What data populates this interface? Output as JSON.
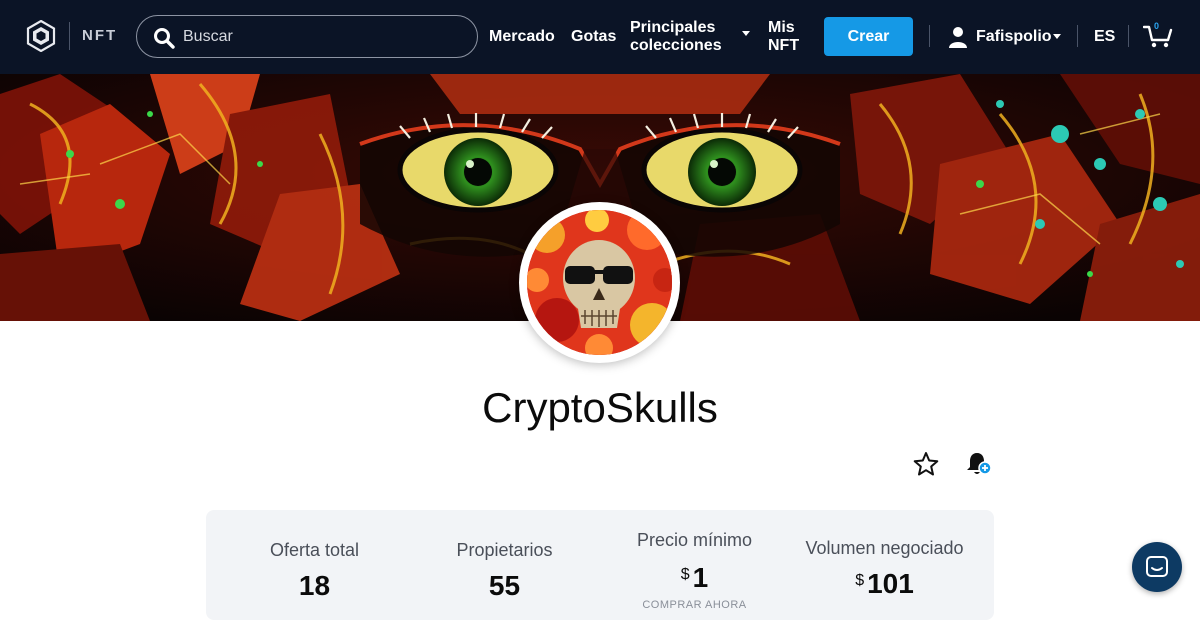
{
  "header": {
    "brand_label": "NFT",
    "search_placeholder": "Buscar",
    "nav": {
      "mercado": "Mercado",
      "gotas": "Gotas",
      "principales_line1": "Principales",
      "principales_line2": "colecciones",
      "mis_line1": "Mis",
      "mis_line2": "NFT"
    },
    "create_label": "Crear",
    "username": "Fafispolio",
    "language": "ES",
    "cart_count": "0"
  },
  "collection": {
    "name": "CryptoSkulls"
  },
  "stats": [
    {
      "label": "Oferta total",
      "value": "18"
    },
    {
      "label": "Propietarios",
      "value": "55"
    },
    {
      "label": "Precio mínimo",
      "currency": "$",
      "value": "1",
      "sub": "COMPRAR AHORA"
    },
    {
      "label": "Volumen negociado",
      "currency": "$",
      "value": "101"
    }
  ],
  "colors": {
    "header_bg": "#0b1426",
    "accent": "#1599e6",
    "chat_button": "#0d3a63"
  },
  "icons": {
    "logo": "crypto-com-logo-icon",
    "search": "search-icon",
    "user": "user-icon",
    "cart": "cart-icon",
    "favorite": "star-icon",
    "notify": "bell-plus-icon",
    "chat": "chat-icon"
  }
}
